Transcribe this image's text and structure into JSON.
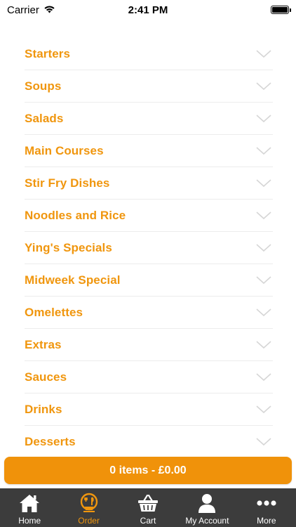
{
  "status_bar": {
    "carrier": "Carrier",
    "time": "2:41 PM"
  },
  "categories": [
    {
      "label": "Starters"
    },
    {
      "label": "Soups"
    },
    {
      "label": "Salads"
    },
    {
      "label": "Main Courses"
    },
    {
      "label": "Stir Fry Dishes"
    },
    {
      "label": "Noodles and Rice"
    },
    {
      "label": "Ying's Specials"
    },
    {
      "label": "Midweek Special"
    },
    {
      "label": "Omelettes"
    },
    {
      "label": "Extras"
    },
    {
      "label": "Sauces"
    },
    {
      "label": "Drinks"
    },
    {
      "label": "Desserts"
    }
  ],
  "cart": {
    "summary": "0 items - £0.00"
  },
  "tab_bar": {
    "tabs": [
      {
        "label": "Home",
        "icon": "home-icon",
        "active": false
      },
      {
        "label": "Order",
        "icon": "order-icon",
        "active": true
      },
      {
        "label": "Cart",
        "icon": "basket-icon",
        "active": false
      },
      {
        "label": "My Account",
        "icon": "user-icon",
        "active": false
      },
      {
        "label": "More",
        "icon": "more-icon",
        "active": false
      }
    ]
  },
  "colors": {
    "accent": "#f0960e",
    "button": "#f0920a",
    "tab_bar_bg": "#3c3c3c",
    "divider": "#ececec",
    "chevron": "#d6d6d6"
  }
}
